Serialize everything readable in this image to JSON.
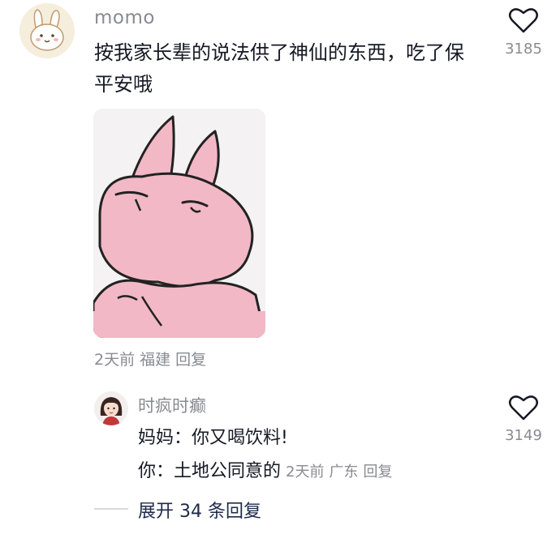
{
  "comment": {
    "username": "momo",
    "text": "按我家长辈的说法供了神仙的东西，吃了保平安哦",
    "like_count": "3185",
    "time": "2天前",
    "location": "福建",
    "reply_label": "回复",
    "avatar_icon": "bunny-avatar-icon",
    "sticker_icon": "pink-bunny-sticker"
  },
  "reply": {
    "username": "时疯时癫",
    "line1": "妈妈：你又喝饮料!",
    "line2": "你：土地公同意的",
    "time": "2天前",
    "location": "广东",
    "reply_label": "回复",
    "like_count": "3149",
    "avatar_icon": "girl-avatar-icon"
  },
  "expand": {
    "label": "展开 34 条回复"
  },
  "colors": {
    "text_primary": "#161823",
    "text_secondary": "#8a8b91",
    "link": "#1f2a4a",
    "sticker_pink": "#f2b8c6"
  }
}
